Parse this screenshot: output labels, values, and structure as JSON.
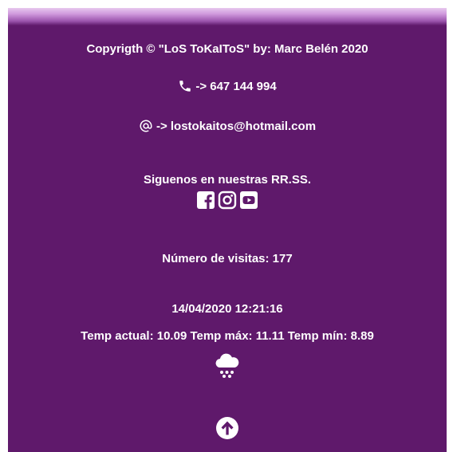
{
  "footer": {
    "copyright": "Copyrigth © \"LoS ToKaIToS\" by: Marc Belén 2020",
    "phone": "-> 647 144 994",
    "email": "-> lostokaitos@hotmail.com",
    "social_heading": "Siguenos en nuestras RR.SS.",
    "social_icons": [
      "facebook-icon",
      "instagram-icon",
      "youtube-icon"
    ],
    "visits": "Número de visitas: 177",
    "datetime": "14/04/2020 12:21:16",
    "weather": "Temp actual: 10.09 Temp máx: 11.11 Temp mín: 8.89",
    "weather_icon": "rain-cloud-icon",
    "back_to_top_icon": "arrow-up-circle-icon",
    "colors": {
      "background": "#5f196b",
      "text": "#ffffff"
    }
  }
}
